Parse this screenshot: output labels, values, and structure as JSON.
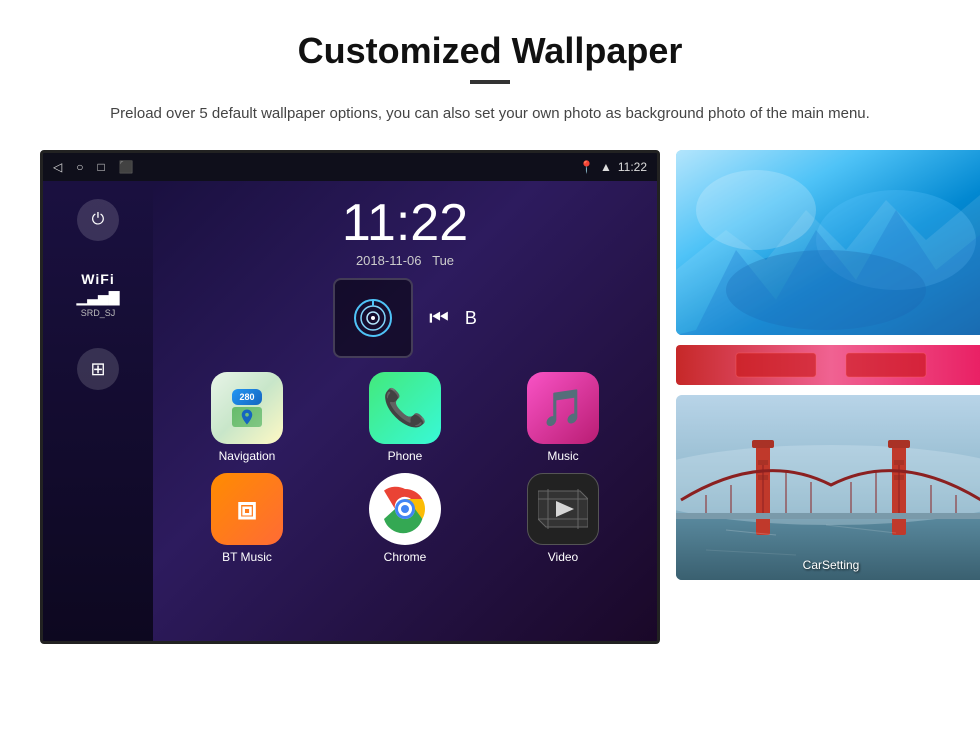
{
  "header": {
    "title": "Customized Wallpaper",
    "subtitle": "Preload over 5 default wallpaper options, you can also set your own photo as background photo of the main menu."
  },
  "device": {
    "statusBar": {
      "navIcons": [
        "◁",
        "○",
        "□",
        "⬛"
      ],
      "statusIcons": [
        "📍",
        "▲",
        "11:22"
      ]
    },
    "clock": {
      "time": "11:22",
      "date": "2018-11-06",
      "day": "Tue"
    },
    "wifi": {
      "label": "WiFi",
      "ssid": "SRD_SJ"
    },
    "apps": [
      {
        "id": "navigation",
        "label": "Navigation",
        "icon": "nav"
      },
      {
        "id": "phone",
        "label": "Phone",
        "icon": "phone"
      },
      {
        "id": "music",
        "label": "Music",
        "icon": "music"
      },
      {
        "id": "bt-music",
        "label": "BT Music",
        "icon": "bluetooth"
      },
      {
        "id": "chrome",
        "label": "Chrome",
        "icon": "chrome"
      },
      {
        "id": "video",
        "label": "Video",
        "icon": "video"
      }
    ]
  },
  "wallpapers": [
    {
      "id": "ice",
      "type": "ice-blue"
    },
    {
      "id": "bridge",
      "type": "golden-gate",
      "label": "CarSetting"
    }
  ]
}
